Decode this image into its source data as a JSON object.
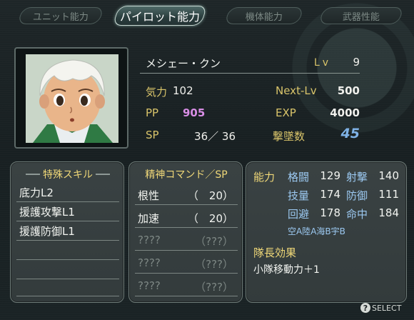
{
  "tabs": [
    "ユニット能力",
    "パイロット能力",
    "機体能力",
    "武器性能"
  ],
  "pilot": {
    "name": "メシェー・クン",
    "lv_label": "Lv",
    "lv": "9",
    "kiryoku_label": "気力",
    "kiryoku": "102",
    "pp_label": "PP",
    "pp": "905",
    "sp_label": "SP",
    "sp": "36／ 36",
    "nextlv_label": "Next-Lv",
    "nextlv": "500",
    "exp_label": "EXP",
    "exp": "4000",
    "kills_label": "撃墜数",
    "kills": "45"
  },
  "skills": {
    "title": "特殊スキル",
    "items": [
      "底力L2",
      "援護攻撃L1",
      "援護防御L1",
      "",
      "",
      "",
      ""
    ]
  },
  "spirit": {
    "title": "精神コマンド／SP",
    "items": [
      {
        "name": "根性",
        "cost": "（　20）"
      },
      {
        "name": "加速",
        "cost": "（　20）"
      },
      {
        "name": "????",
        "cost": "（???）"
      },
      {
        "name": "????",
        "cost": "（???）"
      },
      {
        "name": "????",
        "cost": "（???）"
      }
    ]
  },
  "ability": {
    "title": "能力",
    "stats": [
      {
        "name": "格闘",
        "value": "129"
      },
      {
        "name": "射撃",
        "value": "140"
      },
      {
        "name": "技量",
        "value": "174"
      },
      {
        "name": "防御",
        "value": "111"
      },
      {
        "name": "回避",
        "value": "178"
      },
      {
        "name": "命中",
        "value": "184"
      }
    ],
    "terrain": "空A陸A海B宇B",
    "captain_title": "隊長効果",
    "captain_effect": "小隊移動力＋1"
  },
  "hint": {
    "icon": "?",
    "label": "SELECT"
  }
}
